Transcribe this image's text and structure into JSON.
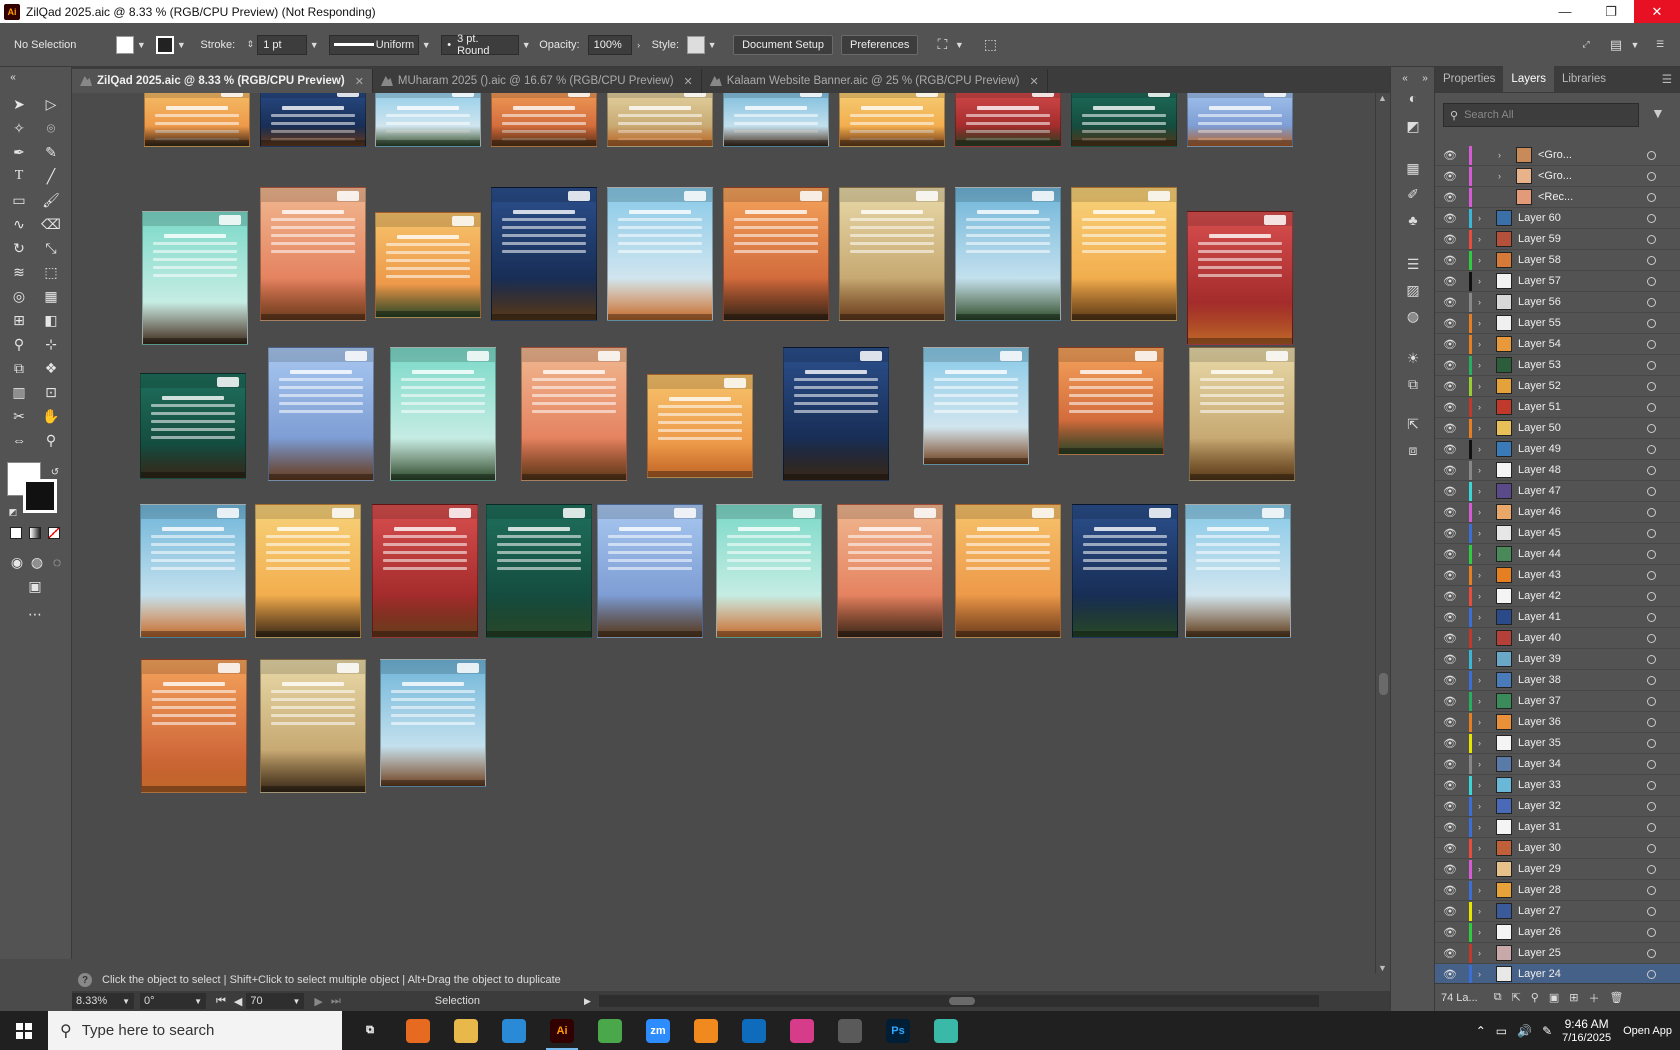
{
  "window": {
    "title": "ZilQad 2025.aic @ 8.33 % (RGB/CPU Preview)  (Not Responding)",
    "app_icon": "Ai",
    "minimize": "—",
    "restore": "❐",
    "close": "✕"
  },
  "control": {
    "selection": "No Selection",
    "stroke_label": "Stroke:",
    "stroke_weight": "1 pt",
    "profile": "Uniform",
    "brush": "3 pt. Round",
    "opacity_label": "Opacity:",
    "opacity": "100%",
    "style_label": "Style:",
    "document_setup": "Document Setup",
    "preferences": "Preferences"
  },
  "tabs": [
    {
      "label": "ZilQad 2025.aic @ 8.33 % (RGB/CPU Preview)",
      "close": "✕"
    },
    {
      "label": "MUharam 2025 ().aic @ 16.67 % (RGB/CPU Preview)",
      "close": "✕"
    },
    {
      "label": "Kalaam Website Banner.aic @ 25 % (RGB/CPU Preview)",
      "close": "✕"
    }
  ],
  "hint": {
    "q": "?",
    "text": "Click the object to select  |  Shift+Click to select multiple object  |  Alt+Drag the object to duplicate"
  },
  "status": {
    "zoom": "8.33%",
    "rotation": "0°",
    "artboard": "70",
    "tool": "Selection"
  },
  "panel": {
    "tabs": [
      "Properties",
      "Layers",
      "Libraries"
    ],
    "search_placeholder": "Search All",
    "footer_count": "74 La..."
  },
  "layers": [
    {
      "name": "<Gro...",
      "color": "#d65cd6",
      "thumb": "#c98a5a",
      "expand": "›",
      "indent": true
    },
    {
      "name": "<Gro...",
      "color": "#d65cd6",
      "thumb": "#e8b38a",
      "expand": "›",
      "indent": true
    },
    {
      "name": "<Rec...",
      "color": "#d65cd6",
      "thumb": "#e39a78",
      "expand": "",
      "indent": true
    },
    {
      "name": "Layer 60",
      "color": "#3bb6d6",
      "thumb": "#3a6fa8"
    },
    {
      "name": "Layer 59",
      "color": "#e74c3c",
      "thumb": "#b5503a"
    },
    {
      "name": "Layer 58",
      "color": "#2ecc40",
      "thumb": "#d67a3a"
    },
    {
      "name": "Layer 57",
      "color": "#111111",
      "thumb": "#f2f2f2"
    },
    {
      "name": "Layer 56",
      "color": "#888888",
      "thumb": "#d8d8d8"
    },
    {
      "name": "Layer 55",
      "color": "#e67e22",
      "thumb": "#f0f0f0"
    },
    {
      "name": "Layer 54",
      "color": "#e67e22",
      "thumb": "#e89a3a"
    },
    {
      "name": "Layer 53",
      "color": "#27ae60",
      "thumb": "#2b5d3a"
    },
    {
      "name": "Layer 52",
      "color": "#9acd32",
      "thumb": "#e6a23a"
    },
    {
      "name": "Layer 51",
      "color": "#c0392b",
      "thumb": "#c0392b"
    },
    {
      "name": "Layer 50",
      "color": "#e67e22",
      "thumb": "#e8c05a"
    },
    {
      "name": "Layer 49",
      "color": "#111111",
      "thumb": "#3a7ab8"
    },
    {
      "name": "Layer 48",
      "color": "#888888",
      "thumb": "#f4f4f4"
    },
    {
      "name": "Layer 47",
      "color": "#3bd6d6",
      "thumb": "#5a4a8a"
    },
    {
      "name": "Layer 46",
      "color": "#d65cd6",
      "thumb": "#e8a86a"
    },
    {
      "name": "Layer 45",
      "color": "#3b6fd6",
      "thumb": "#e6e6e6"
    },
    {
      "name": "Layer 44",
      "color": "#2ecc40",
      "thumb": "#4a8a5a"
    },
    {
      "name": "Layer 43",
      "color": "#e67e22",
      "thumb": "#e67e22"
    },
    {
      "name": "Layer 42",
      "color": "#e74c3c",
      "thumb": "#f4f4f4"
    },
    {
      "name": "Layer 41",
      "color": "#3b6fd6",
      "thumb": "#2a4a8a"
    },
    {
      "name": "Layer 40",
      "color": "#c0392b",
      "thumb": "#b5403a"
    },
    {
      "name": "Layer 39",
      "color": "#3bb6d6",
      "thumb": "#6aa8c8"
    },
    {
      "name": "Layer 38",
      "color": "#3b6fd6",
      "thumb": "#4a7ab8"
    },
    {
      "name": "Layer 37",
      "color": "#27ae60",
      "thumb": "#3a8a5a"
    },
    {
      "name": "Layer 36",
      "color": "#e67e22",
      "thumb": "#e8913a"
    },
    {
      "name": "Layer 35",
      "color": "#e6e600",
      "thumb": "#f4f4f4"
    },
    {
      "name": "Layer 34",
      "color": "#888888",
      "thumb": "#5a7aa8"
    },
    {
      "name": "Layer 33",
      "color": "#3bd6d6",
      "thumb": "#6ab8d8"
    },
    {
      "name": "Layer 32",
      "color": "#3b6fd6",
      "thumb": "#4a6ab8"
    },
    {
      "name": "Layer 31",
      "color": "#3b6fd6",
      "thumb": "#f4f4f4"
    },
    {
      "name": "Layer 30",
      "color": "#e74c3c",
      "thumb": "#c0603a"
    },
    {
      "name": "Layer 29",
      "color": "#d65cd6",
      "thumb": "#e8c08a"
    },
    {
      "name": "Layer 28",
      "color": "#3b6fd6",
      "thumb": "#e8a23a"
    },
    {
      "name": "Layer 27",
      "color": "#e6e600",
      "thumb": "#3a5a9a"
    },
    {
      "name": "Layer 26",
      "color": "#2ecc40",
      "thumb": "#f4f4f4"
    },
    {
      "name": "Layer 25",
      "color": "#c0392b",
      "thumb": "#c8a8a8"
    },
    {
      "name": "Layer 24",
      "color": "#3b6fd6",
      "thumb": "#e8e8e8",
      "selected": true
    }
  ],
  "artboards": {
    "palette": [
      [
        "#f7c36b",
        "#e8863a"
      ],
      [
        "#2b4f8c",
        "#0f1f3d"
      ],
      [
        "#87c9e8",
        "#f2f2f2"
      ],
      [
        "#f5a35c",
        "#c2522d"
      ],
      [
        "#e8d9a8",
        "#b8935a"
      ],
      [
        "#6fb5d9",
        "#e9f4f7"
      ],
      [
        "#f7d27a",
        "#f09d3a"
      ],
      [
        "#d94f4f",
        "#8c1c1c"
      ],
      [
        "#1f6f5c",
        "#0f3d33"
      ],
      [
        "#a8c8f0",
        "#6a8ac8"
      ],
      [
        "#7ad9c8",
        "#e8f5f0"
      ],
      [
        "#f0b890",
        "#e06a4a"
      ]
    ],
    "scene_colors": [
      "#3a2a1a",
      "#6b3f1f",
      "#2a4a2a",
      "#5a3a1a",
      "#c26a2a"
    ]
  },
  "taskbar": {
    "search_placeholder": "Type here to search",
    "apps": [
      {
        "name": "task-view-icon",
        "label": "⧉",
        "color": "#202020"
      },
      {
        "name": "firefox-icon",
        "label": "",
        "color": "#e66a1f"
      },
      {
        "name": "file-explorer-icon",
        "label": "",
        "color": "#e8b84a"
      },
      {
        "name": "vscode-icon",
        "label": "",
        "color": "#2a8ad6"
      },
      {
        "name": "illustrator-icon",
        "label": "Ai",
        "color": "#310000",
        "active": true
      },
      {
        "name": "chrome-icon",
        "label": "",
        "color": "#4aa84a"
      },
      {
        "name": "zoom-icon",
        "label": "zm",
        "color": "#2d8cff"
      },
      {
        "name": "xampp-icon",
        "label": "",
        "color": "#f08a1f"
      },
      {
        "name": "outlook-icon",
        "label": "",
        "color": "#0f6cbd"
      },
      {
        "name": "creative-cloud-icon",
        "label": "",
        "color": "#d63c8a"
      },
      {
        "name": "pen-tool-icon",
        "label": "",
        "color": "#5a5a5a"
      },
      {
        "name": "photoshop-icon",
        "label": "Ps",
        "color": "#001e36"
      },
      {
        "name": "app-icon",
        "label": "",
        "color": "#3ab8a8"
      }
    ],
    "time": "9:46 AM",
    "date": "7/16/2025",
    "open_app": "Open App"
  }
}
